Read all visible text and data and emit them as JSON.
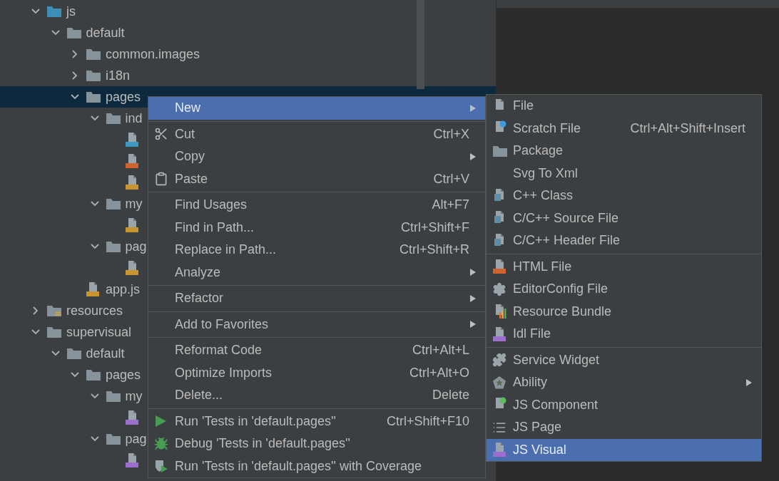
{
  "tree": [
    {
      "name": "js",
      "kind": "module-folder",
      "expanded": true,
      "selected": false,
      "children": [
        {
          "name": "default",
          "kind": "folder",
          "expanded": true,
          "selected": false,
          "children": [
            {
              "name": "common.images",
              "kind": "folder",
              "expanded": false,
              "selected": false
            },
            {
              "name": "i18n",
              "kind": "folder",
              "expanded": false,
              "selected": false
            },
            {
              "name": "pages",
              "kind": "folder",
              "expanded": true,
              "selected": true,
              "children": [
                {
                  "name": "ind",
                  "kind": "folder",
                  "expanded": true,
                  "selected": false,
                  "children": [
                    {
                      "kind": "css",
                      "selected": false
                    },
                    {
                      "kind": "html",
                      "selected": false
                    },
                    {
                      "kind": "js",
                      "selected": false
                    }
                  ]
                },
                {
                  "name": "my",
                  "kind": "folder",
                  "expanded": true,
                  "selected": false,
                  "children": [
                    {
                      "kind": "js",
                      "selected": false
                    }
                  ]
                },
                {
                  "name": "pag",
                  "kind": "folder",
                  "expanded": true,
                  "selected": false,
                  "children": [
                    {
                      "kind": "js",
                      "selected": false
                    }
                  ]
                }
              ]
            },
            {
              "name": "app.js",
              "kind": "js",
              "selected": false
            }
          ]
        }
      ]
    },
    {
      "name": "resources",
      "kind": "resource-folder",
      "expanded": false,
      "selected": false
    },
    {
      "name": "supervisual",
      "kind": "folder",
      "expanded": true,
      "selected": false,
      "children": [
        {
          "name": "default",
          "kind": "folder",
          "expanded": true,
          "selected": false,
          "children": [
            {
              "name": "pages",
              "kind": "folder",
              "expanded": true,
              "selected": false,
              "children": [
                {
                  "name": "my",
                  "kind": "folder",
                  "expanded": true,
                  "selected": false,
                  "children": [
                    {
                      "kind": "visual",
                      "selected": false
                    }
                  ]
                },
                {
                  "name": "pag",
                  "kind": "folder",
                  "expanded": true,
                  "selected": false,
                  "children": [
                    {
                      "kind": "visual",
                      "selected": false
                    }
                  ]
                }
              ]
            }
          ]
        }
      ]
    }
  ],
  "context_menu": {
    "groups": [
      [
        {
          "label": "New",
          "submenu": true,
          "selected": true
        }
      ],
      [
        {
          "label": "Cut",
          "kind": "scissors",
          "shortcut": "Ctrl+X",
          "submenu": false,
          "selected": false
        },
        {
          "label": "Copy",
          "submenu": true,
          "selected": false
        },
        {
          "label": "Paste",
          "kind": "clipboard",
          "shortcut": "Ctrl+V",
          "submenu": false,
          "selected": false
        }
      ],
      [
        {
          "label": "Find Usages",
          "shortcut": "Alt+F7",
          "submenu": false,
          "selected": false
        },
        {
          "label": "Find in Path...",
          "shortcut": "Ctrl+Shift+F",
          "submenu": false,
          "selected": false
        },
        {
          "label": "Replace in Path...",
          "shortcut": "Ctrl+Shift+R",
          "submenu": false,
          "selected": false
        },
        {
          "label": "Analyze",
          "submenu": true,
          "selected": false
        }
      ],
      [
        {
          "label": "Refactor",
          "submenu": true,
          "selected": false
        }
      ],
      [
        {
          "label": "Add to Favorites",
          "submenu": true,
          "selected": false
        }
      ],
      [
        {
          "label": "Reformat Code",
          "shortcut": "Ctrl+Alt+L",
          "submenu": false,
          "selected": false
        },
        {
          "label": "Optimize Imports",
          "shortcut": "Ctrl+Alt+O",
          "submenu": false,
          "selected": false
        },
        {
          "label": "Delete...",
          "shortcut": "Delete",
          "submenu": false,
          "selected": false
        }
      ],
      [
        {
          "label": "Run 'Tests in 'default.pages''",
          "kind": "run",
          "shortcut": "Ctrl+Shift+F10",
          "submenu": false,
          "selected": false
        },
        {
          "label": "Debug 'Tests in 'default.pages''",
          "kind": "debug",
          "submenu": false,
          "selected": false
        },
        {
          "label": "Run 'Tests in 'default.pages'' with Coverage",
          "kind": "coverage",
          "submenu": false,
          "selected": false
        }
      ]
    ]
  },
  "new_submenu": {
    "groups": [
      [
        {
          "label": "File",
          "kind": "file",
          "submenu": false,
          "selected": false
        },
        {
          "label": "Scratch File",
          "kind": "scratch",
          "shortcut": "Ctrl+Alt+Shift+Insert",
          "submenu": false,
          "selected": false
        },
        {
          "label": "Package",
          "kind": "package",
          "submenu": false,
          "selected": false
        },
        {
          "label": "Svg To Xml",
          "submenu": false,
          "selected": false
        },
        {
          "label": "C++ Class",
          "kind": "cpp",
          "submenu": false,
          "selected": false
        },
        {
          "label": "C/C++ Source File",
          "kind": "csource",
          "submenu": false,
          "selected": false
        },
        {
          "label": "C/C++ Header File",
          "kind": "cheader",
          "submenu": false,
          "selected": false
        }
      ],
      [
        {
          "label": "HTML File",
          "kind": "html",
          "submenu": false,
          "selected": false
        },
        {
          "label": "EditorConfig File",
          "kind": "gear",
          "submenu": false,
          "selected": false
        },
        {
          "label": "Resource Bundle",
          "kind": "bundle",
          "submenu": false,
          "selected": false
        },
        {
          "label": "Idl File",
          "kind": "idl",
          "submenu": false,
          "selected": false
        }
      ],
      [
        {
          "label": "Service Widget",
          "kind": "puzzle",
          "submenu": false,
          "selected": false
        },
        {
          "label": "Ability",
          "kind": "ability",
          "submenu": true,
          "selected": false
        },
        {
          "label": "JS Component",
          "kind": "component",
          "submenu": false,
          "selected": false
        },
        {
          "label": "JS Page",
          "kind": "list",
          "submenu": false,
          "selected": false
        },
        {
          "label": "JS Visual",
          "kind": "visual",
          "submenu": false,
          "selected": true
        }
      ]
    ]
  }
}
